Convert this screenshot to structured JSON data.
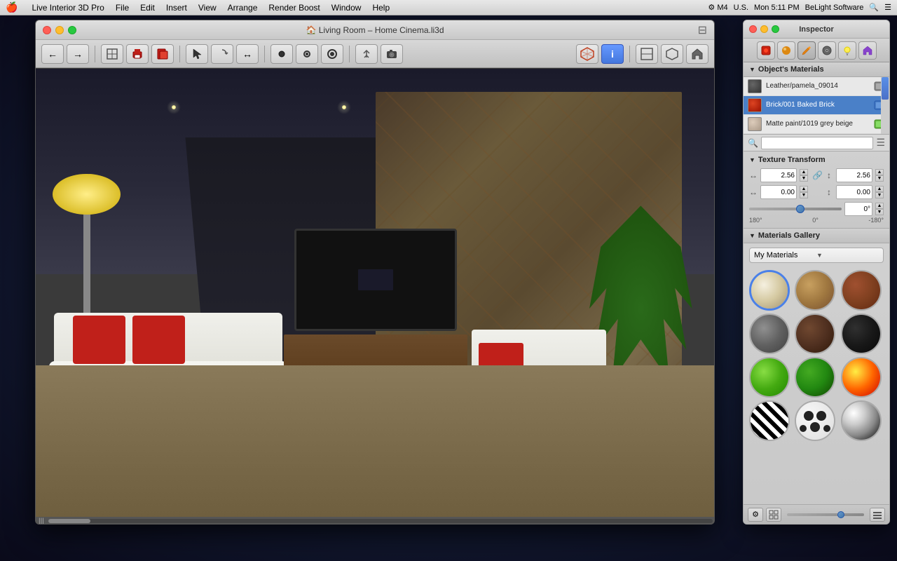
{
  "menubar": {
    "apple": "🍎",
    "items": [
      {
        "label": "Live Interior 3D Pro"
      },
      {
        "label": "File"
      },
      {
        "label": "Edit"
      },
      {
        "label": "Insert"
      },
      {
        "label": "View"
      },
      {
        "label": "Arrange"
      },
      {
        "label": "Render Boost"
      },
      {
        "label": "Window"
      },
      {
        "label": "Help"
      }
    ],
    "right_items": [
      "M4",
      "U.S.",
      "Mon 5:11 PM",
      "BeLight Software"
    ]
  },
  "main_window": {
    "title": "🏠 Living Room – Home Cinema.li3d",
    "title_short": "Living Room – Home Cinema.li3d"
  },
  "toolbar": {
    "buttons": [
      "←",
      "→",
      "🏠",
      "🖨️",
      "📋",
      "↖",
      "⟳",
      "↔",
      "⬤",
      "◎",
      "◉",
      "⚙",
      "📷",
      "🔧",
      "ℹ",
      "⬜",
      "🏠",
      "🏠"
    ]
  },
  "inspector": {
    "title": "Inspector",
    "tabs": [
      {
        "label": "🔴",
        "type": "materials-icon"
      },
      {
        "label": "🟠",
        "type": "sphere-icon"
      },
      {
        "label": "✏️",
        "type": "edit-icon"
      },
      {
        "label": "💿",
        "type": "disc-icon"
      },
      {
        "label": "💡",
        "type": "light-icon"
      },
      {
        "label": "🏠",
        "type": "home-icon"
      }
    ],
    "objects_materials": {
      "label": "Object's Materials",
      "items": [
        {
          "name": "Leather/pamela_09014",
          "color": "#555555",
          "selected": false
        },
        {
          "name": "Brick/001 Baked Brick",
          "color": "#cc3311",
          "selected": true
        },
        {
          "name": "Matte paint/1019 grey beige",
          "color": "#ccbbaa",
          "selected": false
        }
      ]
    },
    "texture_transform": {
      "label": "Texture Transform",
      "width_value": "2.56",
      "height_value": "2.56",
      "offset_x": "0.00",
      "offset_y": "0.00",
      "rotation_value": "0°",
      "rotation_min": "180°",
      "rotation_center": "0°",
      "rotation_max": "-180°"
    },
    "materials_gallery": {
      "label": "Materials Gallery",
      "dropdown_label": "My Materials",
      "materials": [
        {
          "id": "cream",
          "type": "cream"
        },
        {
          "id": "wood-light",
          "type": "wood-light"
        },
        {
          "id": "brick",
          "type": "brick"
        },
        {
          "id": "stone",
          "type": "stone"
        },
        {
          "id": "wood-dark",
          "type": "wood-dark"
        },
        {
          "id": "dark",
          "type": "dark"
        },
        {
          "id": "green-bright",
          "type": "green-bright"
        },
        {
          "id": "green-dark",
          "type": "green-dark"
        },
        {
          "id": "fire",
          "type": "fire"
        },
        {
          "id": "zebra",
          "type": "zebra"
        },
        {
          "id": "spots",
          "type": "spots"
        },
        {
          "id": "chrome",
          "type": "chrome"
        }
      ]
    }
  }
}
